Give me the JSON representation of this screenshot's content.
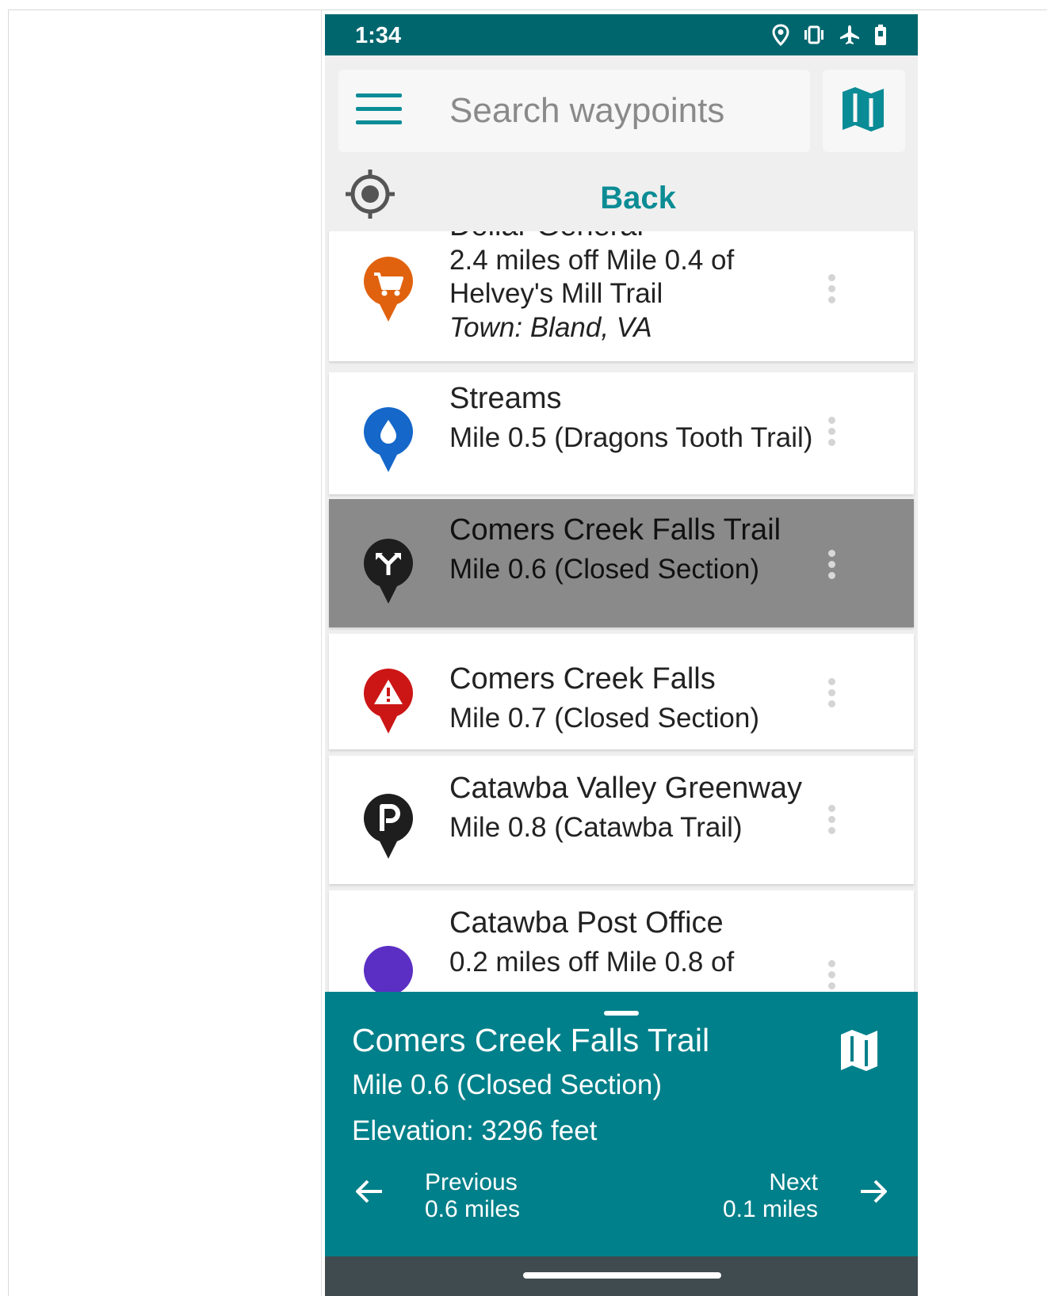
{
  "status_bar": {
    "time": "1:34",
    "icons": [
      "location-icon",
      "vibrate-icon",
      "airplane-icon",
      "battery-icon"
    ]
  },
  "search": {
    "placeholder": "Search waypoints",
    "value": ""
  },
  "toolbar": {
    "back_label": "Back"
  },
  "list": {
    "items": [
      {
        "title": "Dollar General",
        "subtitle": "2.4 miles off Mile 0.4 of Helvey's Mill Trail",
        "town": "Town: Bland, VA",
        "icon": "shopping-cart-icon",
        "color": "#e0620e"
      },
      {
        "title": "Streams",
        "subtitle": "Mile 0.5 (Dragons Tooth Trail)",
        "icon": "water-drop-icon",
        "color": "#1567c9"
      },
      {
        "title": "Comers Creek Falls Trail",
        "subtitle": "Mile 0.6 (Closed Section)",
        "icon": "trail-fork-icon",
        "color": "#1e1e1e",
        "selected": true
      },
      {
        "title": "Comers Creek Falls",
        "subtitle": "Mile 0.7 (Closed Section)",
        "icon": "warning-icon",
        "color": "#cc1616"
      },
      {
        "title": "Catawba Valley Greenway",
        "subtitle": "Mile 0.8 (Catawba Trail)",
        "icon": "parking-icon",
        "color": "#1e1e1e"
      },
      {
        "title": "Catawba Post Office",
        "subtitle": "0.2 miles off Mile 0.8 of",
        "icon": "post-office-icon",
        "color": "#5b2fc4"
      }
    ]
  },
  "bottom_sheet": {
    "title": "Comers Creek Falls Trail",
    "mile": "Mile 0.6 (Closed Section)",
    "elevation": "Elevation: 3296 feet",
    "previous": {
      "label": "Previous",
      "distance": "0.6 miles"
    },
    "next": {
      "label": "Next",
      "distance": "0.1 miles"
    }
  },
  "colors": {
    "status_bar": "#00666e",
    "accent": "#0b8c95",
    "sheet": "#00808a",
    "selected_row": "#8a8a8a"
  }
}
